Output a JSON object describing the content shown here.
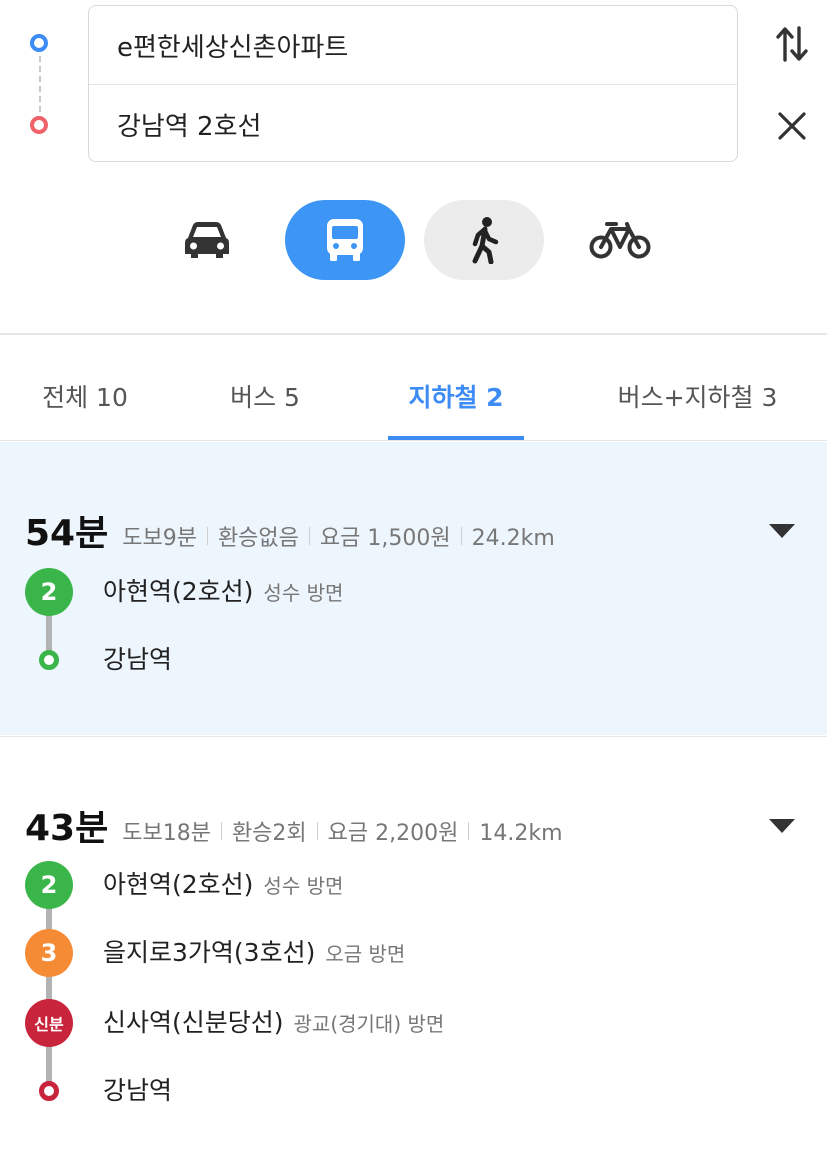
{
  "search": {
    "origin": "e편한세상신촌아파트",
    "destination": "강남역 2호선"
  },
  "icons": {
    "swap": "swap-vertical-icon",
    "close": "close-icon",
    "car": "car-icon",
    "bus": "bus-icon",
    "walk": "walk-icon",
    "bike": "bike-icon"
  },
  "colors": {
    "accent": "#3d8cf5",
    "line2": "#39b54a",
    "line3": "#f68b36",
    "shinbundang": "#c8243b",
    "selected_card_bg": "#edf5fd"
  },
  "tabs": [
    {
      "label": "전체 10"
    },
    {
      "label": "버스 5"
    },
    {
      "label": "지하철 2"
    },
    {
      "label": "버스+지하철 3"
    }
  ],
  "active_tab": "지하철 2",
  "routes": [
    {
      "time": "54분",
      "walk": "도보9분",
      "transfer": "환승없음",
      "fare": "요금 1,500원",
      "distance": "24.2km",
      "steps": [
        {
          "badge": "2",
          "station": "아현역(2호선)",
          "direction": "성수 방면"
        },
        {
          "station": "강남역"
        }
      ]
    },
    {
      "time": "43분",
      "walk": "도보18분",
      "transfer": "환승2회",
      "fare": "요금 2,200원",
      "distance": "14.2km",
      "steps": [
        {
          "badge": "2",
          "station": "아현역(2호선)",
          "direction": "성수 방면"
        },
        {
          "badge": "3",
          "station": "을지로3가역(3호선)",
          "direction": "오금 방면"
        },
        {
          "badge": "신분",
          "station": "신사역(신분당선)",
          "direction": "광교(경기대) 방면"
        },
        {
          "station": "강남역"
        }
      ]
    }
  ]
}
